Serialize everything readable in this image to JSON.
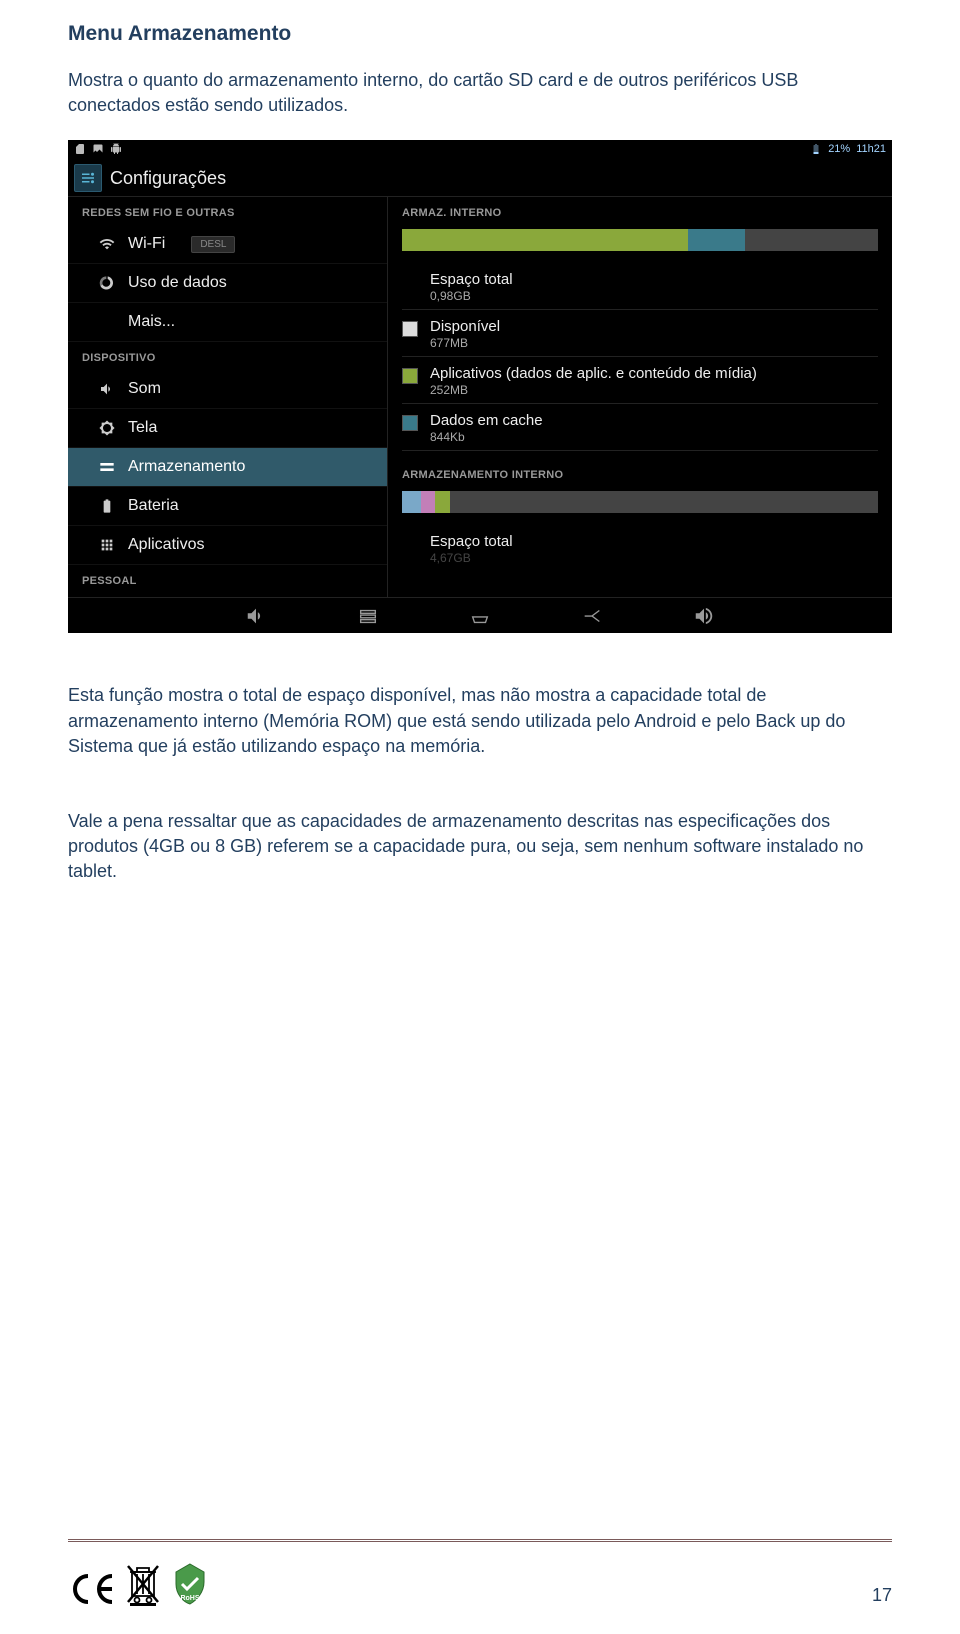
{
  "doc": {
    "heading": "Menu Armazenamento",
    "intro": "Mostra o quanto do armazenamento interno, do cartão SD card e de outros periféricos USB conectados estão sendo utilizados.",
    "para2": "Esta função mostra o total de espaço disponível, mas não mostra a capacidade total de armazenamento interno (Memória ROM) que está sendo utilizada pelo Android e pelo Back up do Sistema que já estão utilizando espaço na memória.",
    "para3": "Vale a pena ressaltar que as capacidades de armazenamento descritas nas especificações dos produtos  (4GB ou 8 GB) referem se a capacidade pura, ou seja, sem nenhum software instalado no tablet.",
    "page_number": "17"
  },
  "shot": {
    "statusbar": {
      "battery_text": "21%",
      "clock": "11h21"
    },
    "settings_title": "Configurações",
    "sidebar": {
      "section1": "REDES SEM FIO E OUTRAS",
      "wifi": "Wi-Fi",
      "wifi_toggle": "DESL",
      "data_usage": "Uso de dados",
      "more": "Mais...",
      "section2": "DISPOSITIVO",
      "sound": "Som",
      "display": "Tela",
      "storage": "Armazenamento",
      "battery": "Bateria",
      "apps": "Aplicativos",
      "section3": "PESSOAL"
    },
    "main": {
      "section_internal": "ARMAZ. INTERNO",
      "bar1_segments": [
        {
          "color": "#8aa83b",
          "pct": 60
        },
        {
          "color": "#3a7a8a",
          "pct": 12
        },
        {
          "color": "#444444",
          "pct": 28
        }
      ],
      "items1": [
        {
          "swatch": null,
          "label": "Espaço total",
          "value": "0,98GB"
        },
        {
          "swatch": "#dddddd",
          "label": "Disponível",
          "value": "677MB"
        },
        {
          "swatch": "#8aa83b",
          "label": "Aplicativos (dados de aplic. e conteúdo de mídia)",
          "value": "252MB"
        },
        {
          "swatch": "#3a7a8a",
          "label": "Dados em cache",
          "value": "844Kb"
        }
      ],
      "section_internal2": "ARMAZENAMENTO INTERNO",
      "bar2_segments": [
        {
          "color": "#7aa8c8",
          "pct": 4
        },
        {
          "color": "#c27fb8",
          "pct": 3
        },
        {
          "color": "#8aa83b",
          "pct": 3
        },
        {
          "color": "#444444",
          "pct": 90
        }
      ],
      "total2_label": "Espaço total",
      "total2_value": "4,67GB"
    }
  }
}
